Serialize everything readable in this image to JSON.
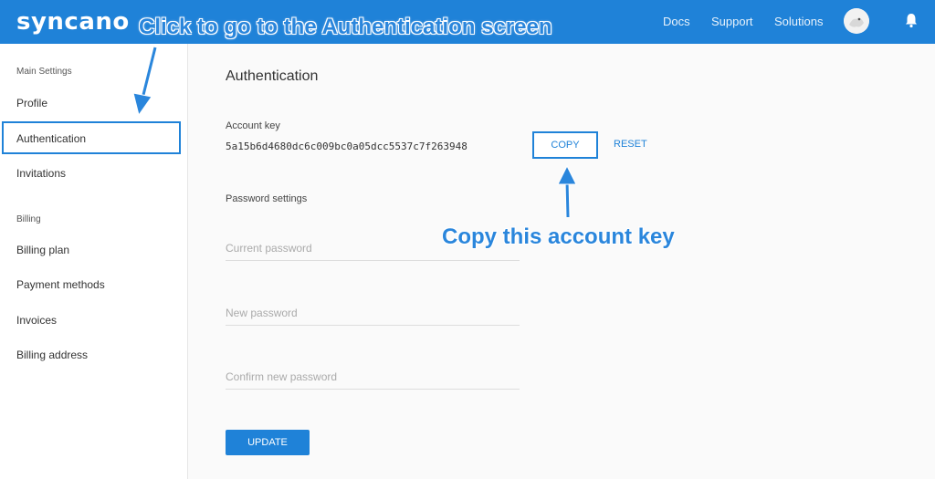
{
  "header": {
    "logo": "syncano",
    "nav": [
      "Docs",
      "Support",
      "Solutions"
    ]
  },
  "sidebar": {
    "main_settings_title": "Main Settings",
    "main_items": [
      "Profile",
      "Authentication",
      "Invitations"
    ],
    "billing_title": "Billing",
    "billing_items": [
      "Billing plan",
      "Payment methods",
      "Invoices",
      "Billing address"
    ]
  },
  "main": {
    "title": "Authentication",
    "account_key_label": "Account key",
    "account_key_value": "5a15b6d4680dc6c009bc0a05dcc5537c7f263948",
    "copy_label": "COPY",
    "reset_label": "RESET",
    "password_settings_label": "Password settings",
    "current_password_placeholder": "Current password",
    "new_password_placeholder": "New password",
    "confirm_password_placeholder": "Confirm new password",
    "update_label": "UPDATE"
  },
  "annotations": {
    "top": "Click to go to the Authentication screen",
    "middle": "Copy this account key"
  },
  "colors": {
    "brand": "#1f82d8"
  }
}
